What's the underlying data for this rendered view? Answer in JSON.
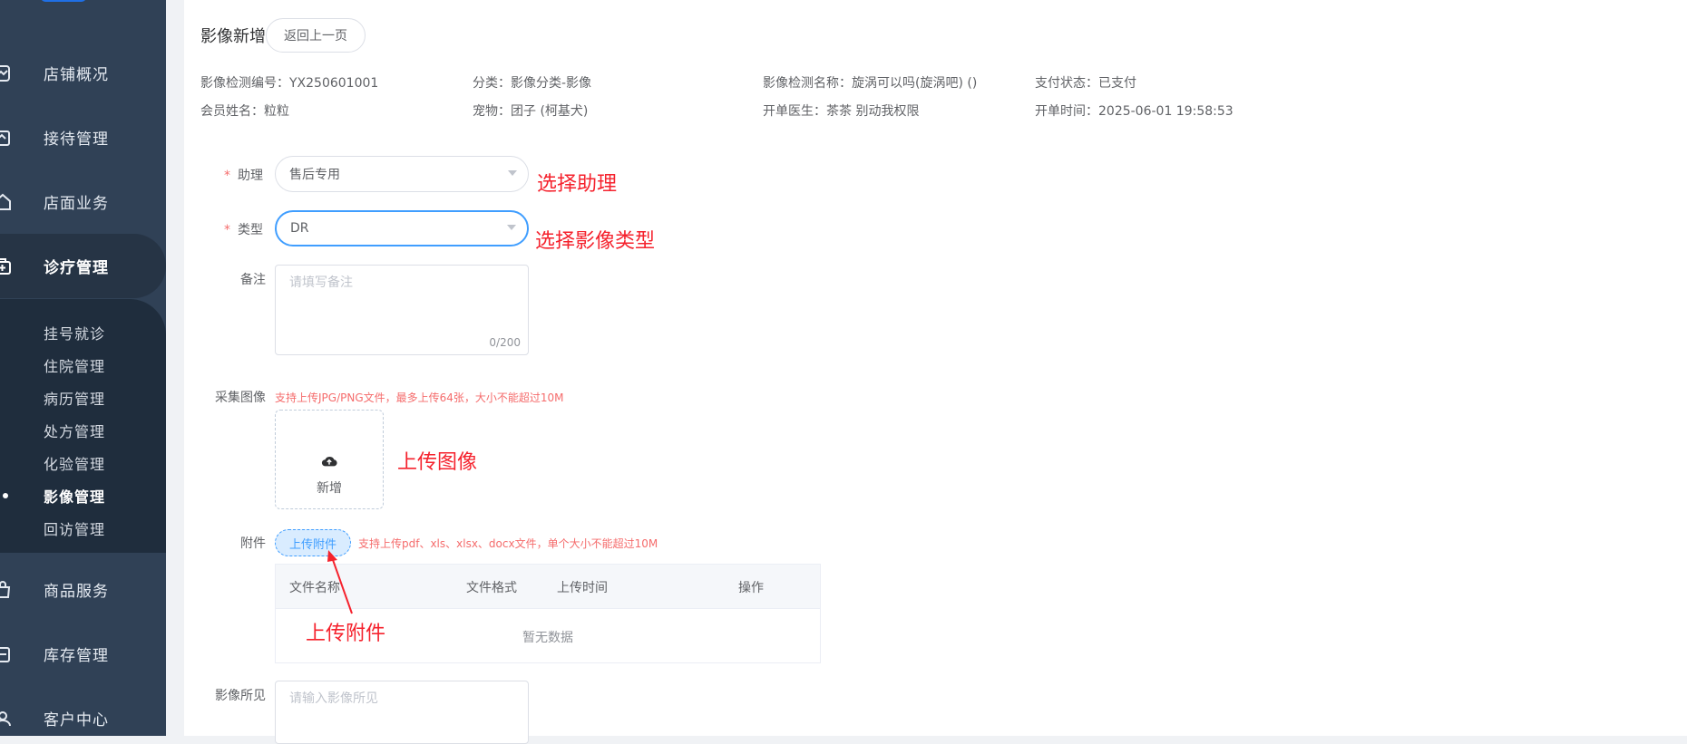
{
  "sidebar": {
    "items": [
      {
        "label": "店铺概况",
        "icon": "store-icon"
      },
      {
        "label": "接待管理",
        "icon": "reception-icon"
      },
      {
        "label": "店面业务",
        "icon": "home-icon"
      },
      {
        "label": "诊疗管理",
        "icon": "medical-kit-icon"
      },
      {
        "label": "商品服务",
        "icon": "bag-icon"
      },
      {
        "label": "库存管理",
        "icon": "inventory-icon"
      },
      {
        "label": "客户中心",
        "icon": "user-icon"
      }
    ],
    "submenu": [
      "挂号就诊",
      "住院管理",
      "病历管理",
      "处方管理",
      "化验管理",
      "影像管理",
      "回访管理"
    ],
    "active_submenu": "影像管理",
    "colors": {
      "bg": "#304156",
      "submenu_bg": "#1f2d3d"
    }
  },
  "header": {
    "title": "影像新增",
    "back_button": "返回上一页"
  },
  "info": {
    "row1": [
      {
        "label": "影像检测编号：",
        "value": "YX250601001"
      },
      {
        "label": "分类：",
        "value": "影像分类-影像"
      },
      {
        "label": "影像检测名称：",
        "value": "旋涡可以吗(旋涡吧) ()"
      },
      {
        "label": "支付状态：",
        "value": "已支付"
      }
    ],
    "row2": [
      {
        "label": "会员姓名：",
        "value": "粒粒"
      },
      {
        "label": "宠物：",
        "value": "团子 (柯基犬)"
      },
      {
        "label": "开单医生：",
        "value": "茶茶 别动我权限"
      },
      {
        "label": "开单时间：",
        "value": "2025-06-01 19:58:53"
      }
    ]
  },
  "form": {
    "required_mark": "*",
    "assistant": {
      "label": "助理",
      "value": "售后专用"
    },
    "type": {
      "label": "类型",
      "value": "DR"
    },
    "remark": {
      "label": "备注",
      "placeholder": "请填写备注",
      "count": "0/200"
    },
    "images": {
      "label": "采集图像",
      "hint": "支持上传JPG/PNG文件，最多上传64张，大小不能超过10M",
      "add_label": "新增"
    },
    "attachment": {
      "label": "附件",
      "button": "上传附件",
      "hint": "支持上传pdf、xls、xlsx、docx文件，单个大小不能超过10M",
      "columns": [
        "文件名称",
        "文件格式",
        "上传时间",
        "操作"
      ],
      "empty": "暂无数据"
    },
    "findings": {
      "label": "影像所见",
      "placeholder": "请输入影像所见"
    }
  },
  "annotations": {
    "assistant": "选择助理",
    "type": "选择影像类型",
    "images": "上传图像",
    "attachment": "上传附件"
  },
  "colors": {
    "accent": "#409eff",
    "annotation": "#f5222d",
    "hint": "#f56c6c"
  }
}
